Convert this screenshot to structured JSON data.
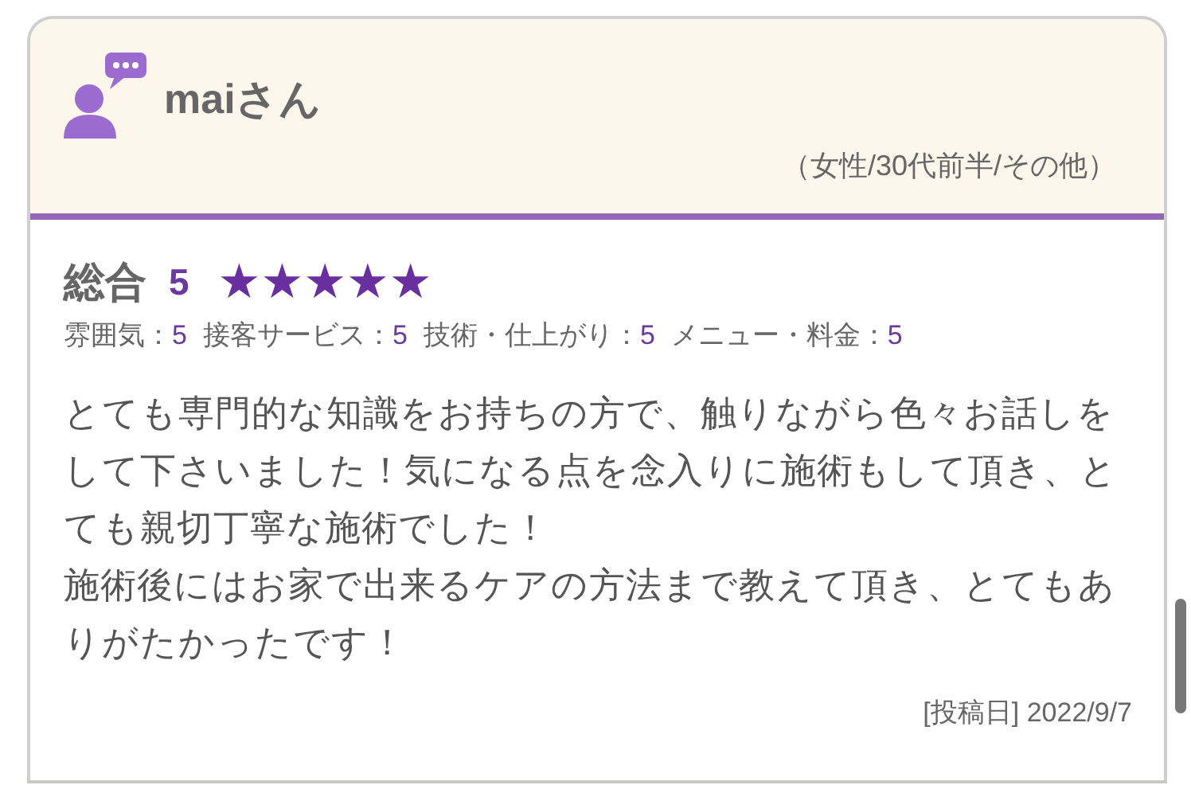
{
  "review": {
    "reviewer": "maiさん",
    "profile": "（女性/30代前半/その他）",
    "overall": {
      "label": "総合",
      "score": "5",
      "stars": 5
    },
    "ratings": [
      {
        "label": "雰囲気：",
        "value": "5"
      },
      {
        "label": "接客サービス：",
        "value": "5"
      },
      {
        "label": "技術・仕上がり：",
        "value": "5"
      },
      {
        "label": "メニュー・料金：",
        "value": "5"
      }
    ],
    "body": [
      "とても専門的な知識をお持ちの方で、触りながら色々お話しをして下さいました！気になる点を念入りに施術もして頂き、とても親切丁寧な施術でした！",
      "施術後にはお家で出来るケアの方法まで教えて頂き、とてもありがたかったです！"
    ],
    "posted": "[投稿日] 2022/9/7"
  }
}
